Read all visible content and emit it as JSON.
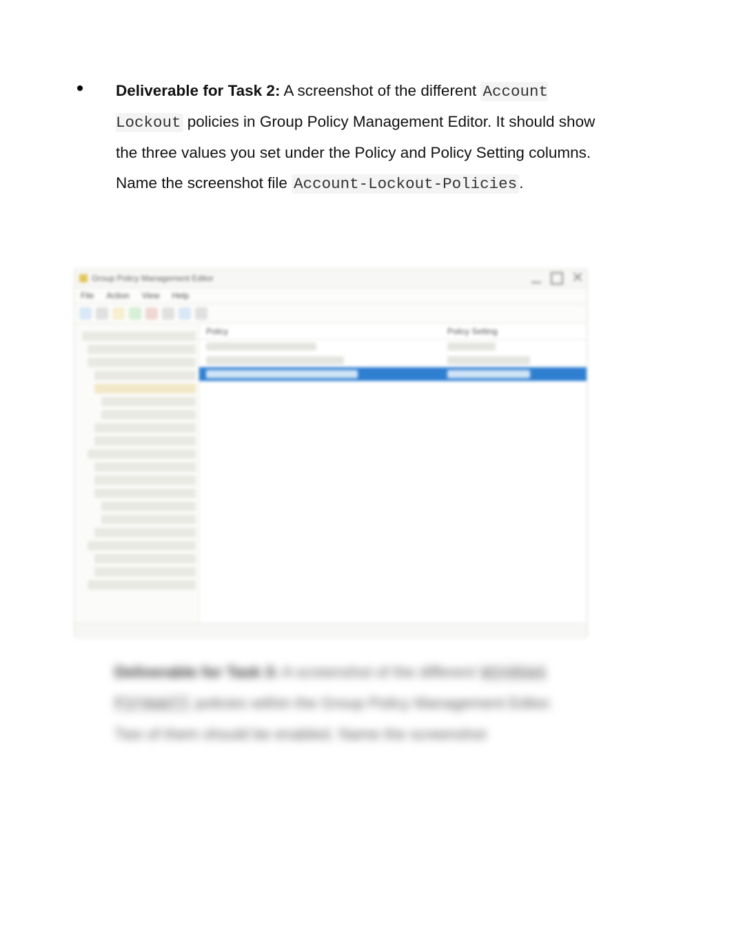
{
  "task2": {
    "label": "Deliverable for Task 2:",
    "text_a": " A screenshot of the different ",
    "code_a": "Account Lockout",
    "text_b": " policies in Group Policy Management Editor. It should show the three values you set under the Policy and Policy Setting columns. Name the screenshot file ",
    "code_b": "Account-Lockout-Policies",
    "text_c": "."
  },
  "screenshot": {
    "window_title": "Group Policy Management Editor",
    "menubar": [
      "File",
      "Action",
      "View",
      "Help"
    ],
    "columns": {
      "policy": "Policy",
      "setting": "Policy Setting"
    },
    "rows_visible": 3,
    "selected_row_index": 2
  },
  "task3_blurred": {
    "label": "Deliverable for Task 3:",
    "text_a": " A screenshot of the different ",
    "code_a": "Windows Firewall",
    "text_b": " policies within the Group Policy Management Editor. Two of them should be enabled. Name the screenshot"
  }
}
